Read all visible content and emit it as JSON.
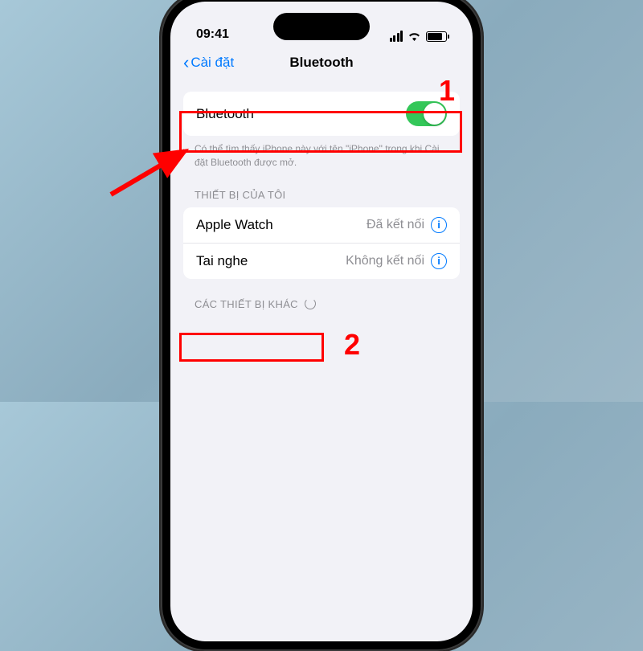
{
  "status_bar": {
    "time": "09:41"
  },
  "nav": {
    "back": "Cài đặt",
    "title": "Bluetooth"
  },
  "bluetooth_row": {
    "label": "Bluetooth"
  },
  "footer_discoverable": "Có thể tìm thấy iPhone này với tên \"iPhone\" trong khi Cài đặt Bluetooth được mở.",
  "sections": {
    "my_devices": "THIẾT BỊ CỦA TÔI",
    "other_devices": "CÁC THIẾT BỊ KHÁC"
  },
  "devices": [
    {
      "name": "Apple Watch",
      "status": "Đã kết nối"
    },
    {
      "name": "Tai nghe",
      "status": "Không kết nối"
    }
  ],
  "annotations": {
    "one": "1",
    "two": "2"
  }
}
